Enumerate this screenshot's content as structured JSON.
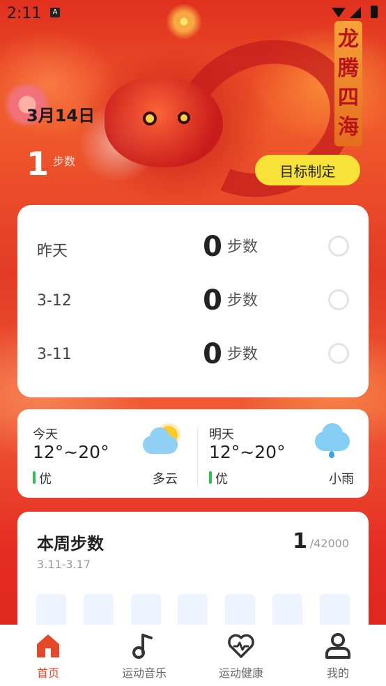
{
  "status_bar": {
    "time": "2:11",
    "notification_icon_letter": "A"
  },
  "banner": {
    "text": [
      "龙",
      "腾",
      "四",
      "海"
    ]
  },
  "header": {
    "date": "3月14日",
    "today_steps": "1",
    "today_steps_unit": "步数",
    "goal_button": "目标制定"
  },
  "history": [
    {
      "label": "昨天",
      "steps": "0",
      "unit": "步数"
    },
    {
      "label": "3-12",
      "steps": "0",
      "unit": "步数"
    },
    {
      "label": "3-11",
      "steps": "0",
      "unit": "步数"
    }
  ],
  "weather": {
    "today": {
      "day": "今天",
      "temp": "12°~20°",
      "air_quality": "优",
      "condition": "多云",
      "icon": "partly-cloudy-icon"
    },
    "tomorrow": {
      "day": "明天",
      "temp": "12°~20°",
      "air_quality": "优",
      "condition": "小雨",
      "icon": "light-rain-icon"
    }
  },
  "week": {
    "title": "本周步数",
    "range": "3.11-3.17",
    "total": "1",
    "goal": "/42000",
    "bars": [
      0,
      0,
      0,
      0,
      0,
      0,
      0
    ]
  },
  "nav": [
    {
      "label": "首页",
      "icon": "home-icon",
      "active": true
    },
    {
      "label": "运动音乐",
      "icon": "music-note-icon",
      "active": false
    },
    {
      "label": "运动健康",
      "icon": "heart-pulse-icon",
      "active": false
    },
    {
      "label": "我的",
      "icon": "profile-icon",
      "active": false
    }
  ],
  "colors": {
    "accent": "#e54828",
    "goal_button": "#f8e23a",
    "air_quality_good": "#2fc04f",
    "bar_empty": "#eef4ff"
  }
}
